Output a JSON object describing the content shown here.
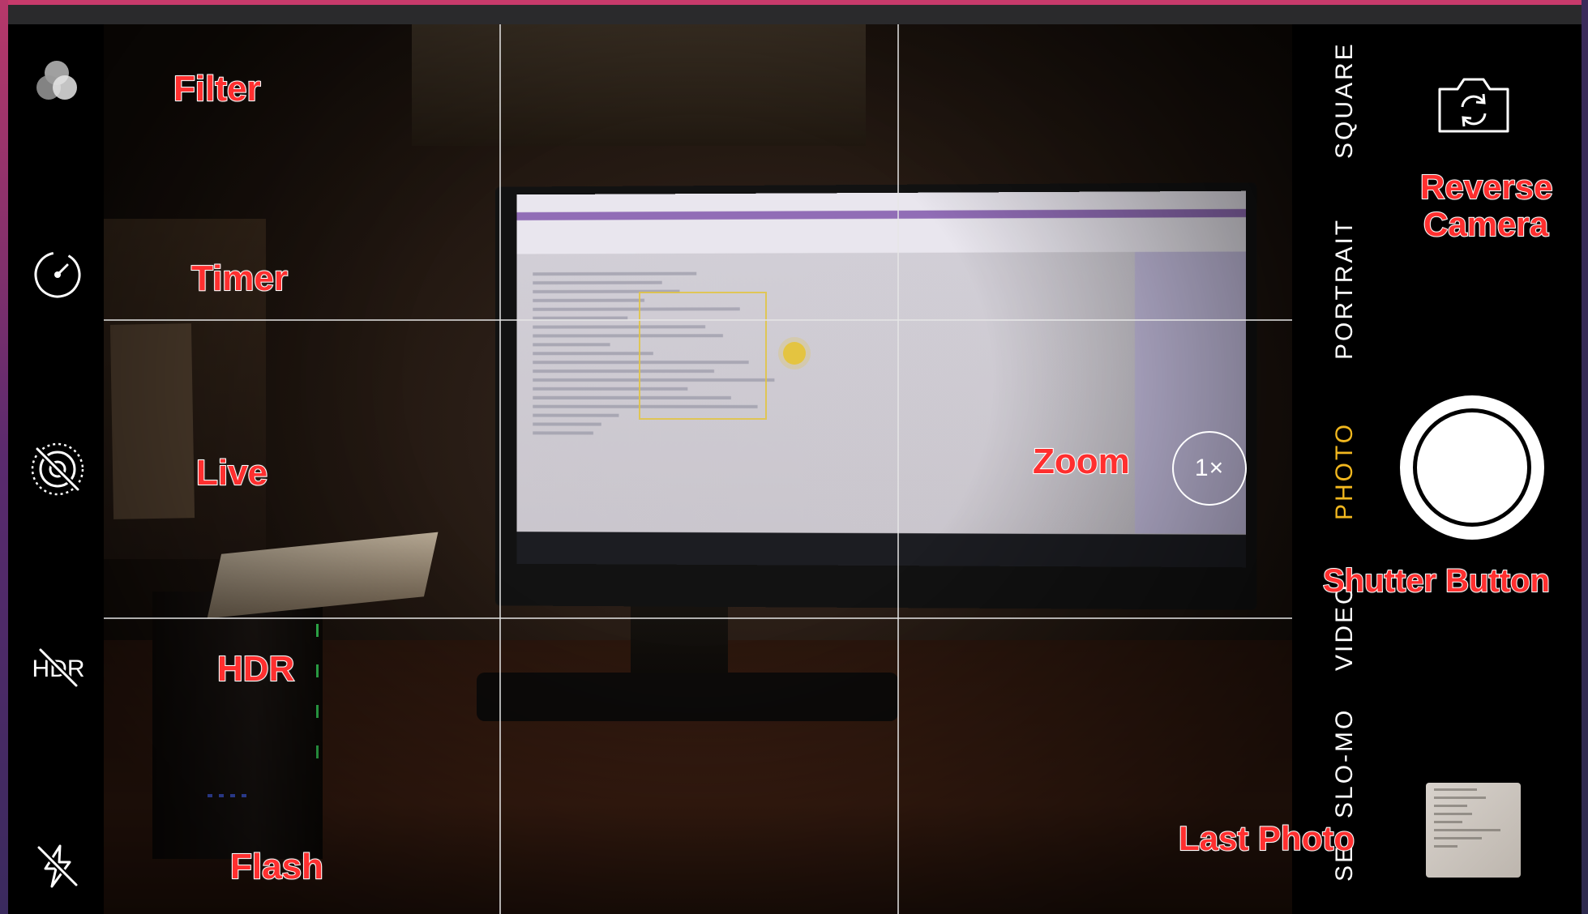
{
  "camera": {
    "left_controls": [
      {
        "name": "filter",
        "icon": "filter-icon"
      },
      {
        "name": "timer",
        "icon": "timer-icon"
      },
      {
        "name": "live",
        "icon": "live-photo-off-icon"
      },
      {
        "name": "hdr",
        "icon": "hdr-off-icon",
        "glyph": "HDR"
      },
      {
        "name": "flash",
        "icon": "flash-off-icon"
      }
    ],
    "zoom_label": "1×",
    "modes": [
      "SQUARE",
      "PORTRAIT",
      "PHOTO",
      "VIDEO",
      "SLO-MO",
      "SE"
    ],
    "active_mode": "PHOTO",
    "accent_color": "#f2b81f",
    "shutter_icon": "shutter-button-icon",
    "reverse_icon": "reverse-camera-icon"
  },
  "annotations": {
    "filter": "Filter",
    "timer": "Timer",
    "live": "Live",
    "hdr": "HDR",
    "flash": "Flash",
    "zoom": "Zoom",
    "reverse_line1": "Reverse",
    "reverse_line2": "Camera",
    "shutter": "Shutter Button",
    "last_photo": "Last Photo"
  },
  "annotation_color": "#ff2f2f"
}
